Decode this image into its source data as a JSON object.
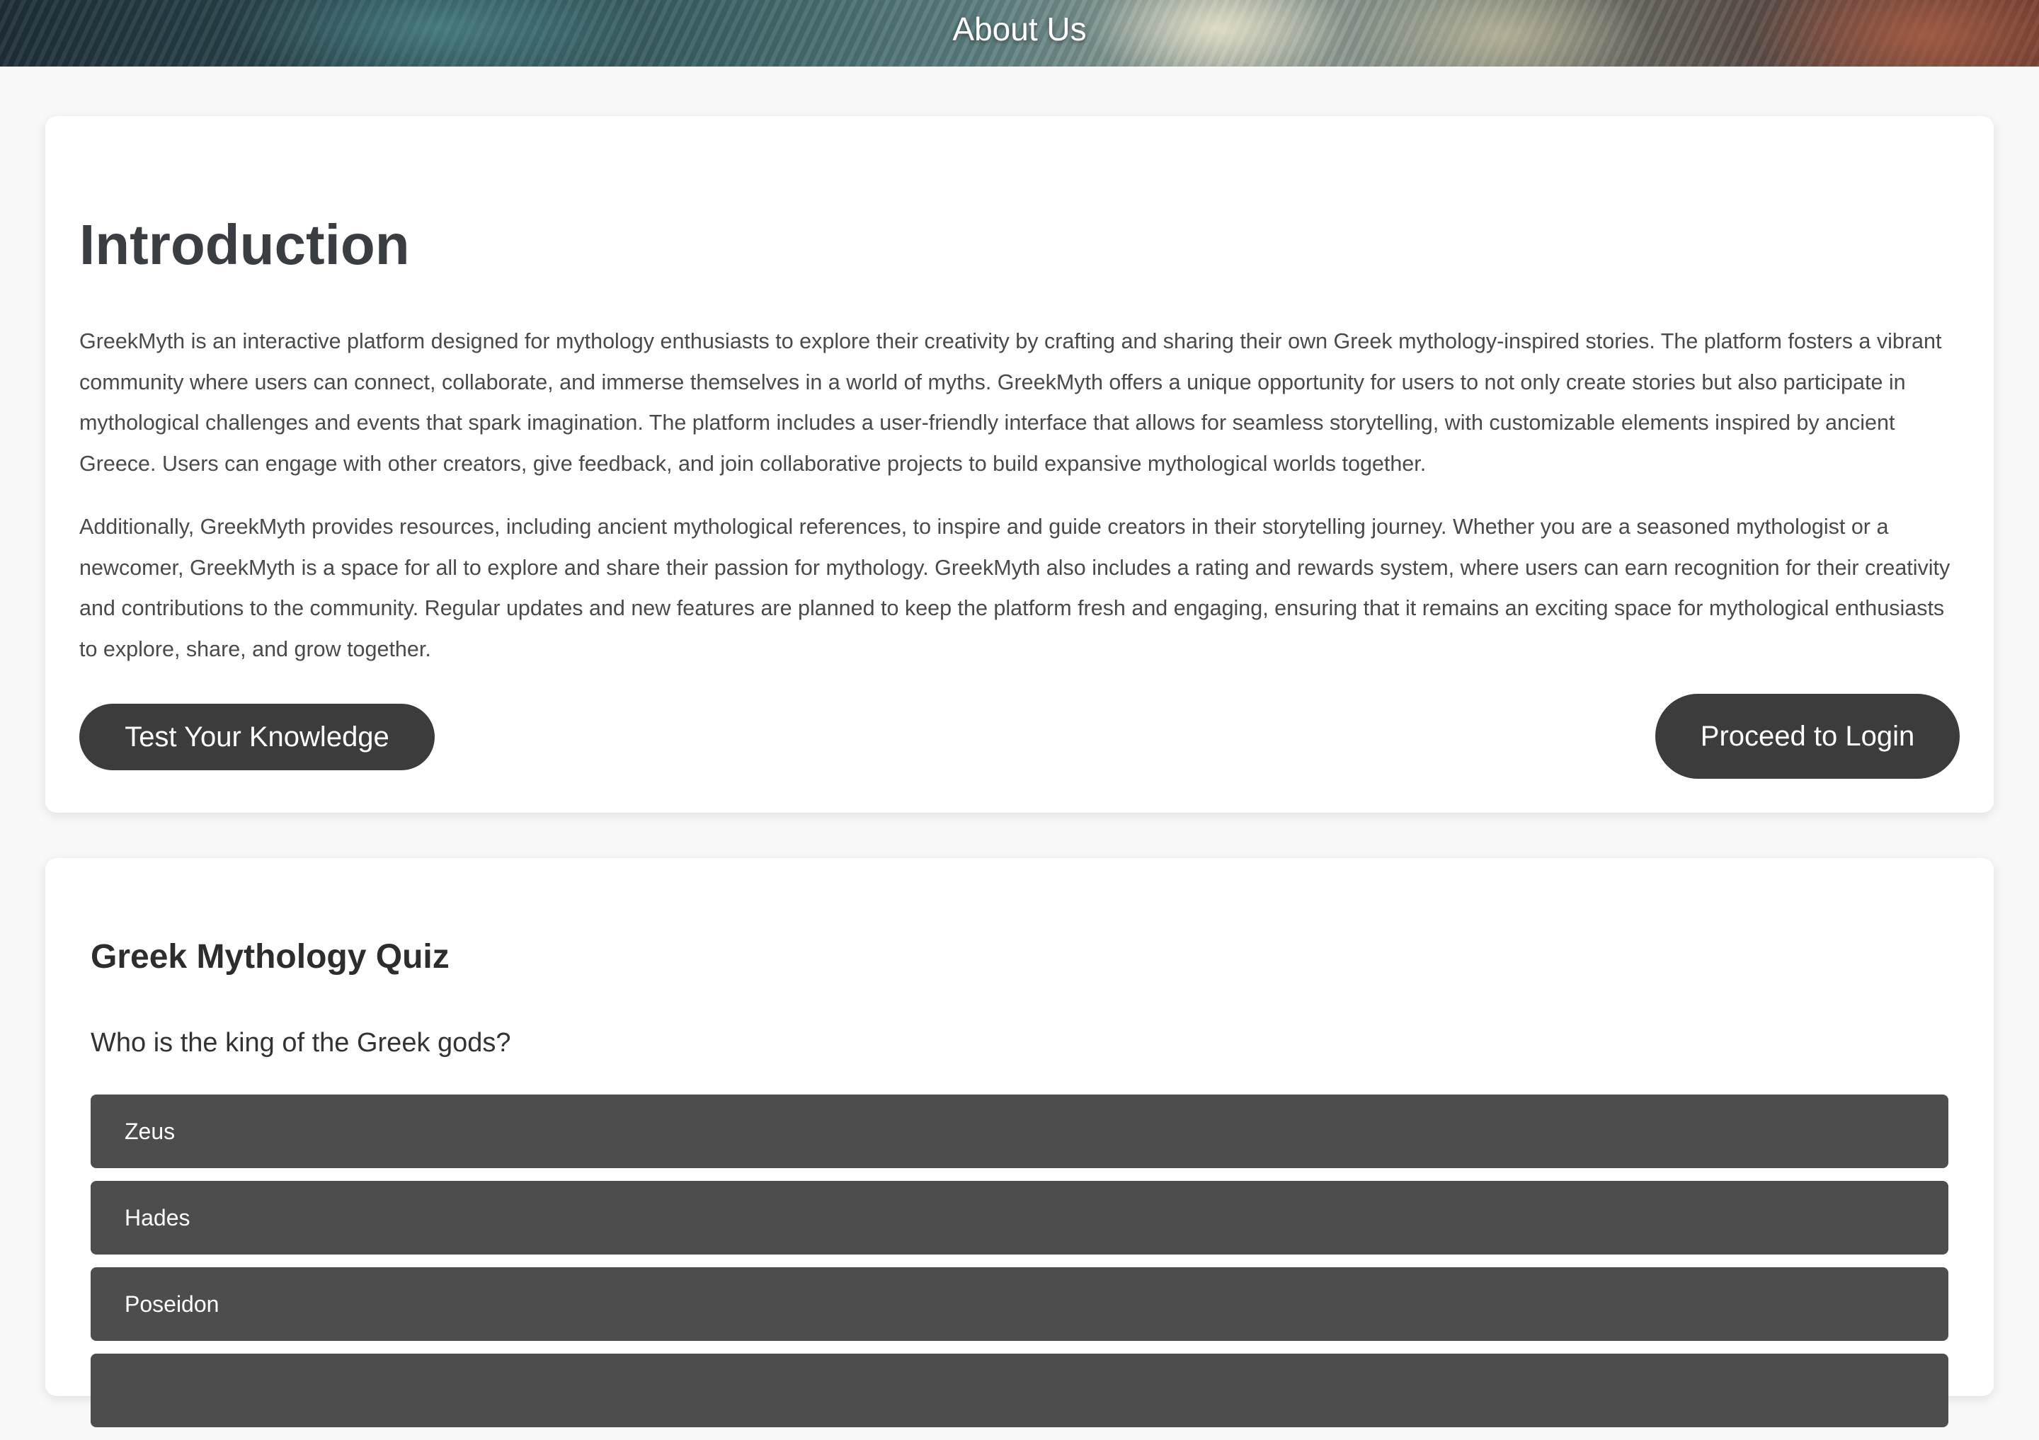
{
  "header": {
    "title": "About Us"
  },
  "intro": {
    "title": "Introduction",
    "paragraphs": [
      "GreekMyth is an interactive platform designed for mythology enthusiasts to explore their creativity by crafting and sharing their own Greek mythology-inspired stories. The platform fosters a vibrant community where users can connect, collaborate, and immerse themselves in a world of myths. GreekMyth offers a unique opportunity for users to not only create stories but also participate in mythological challenges and events that spark imagination. The platform includes a user-friendly interface that allows for seamless storytelling, with customizable elements inspired by ancient Greece. Users can engage with other creators, give feedback, and join collaborative projects to build expansive mythological worlds together.",
      "Additionally, GreekMyth provides resources, including ancient mythological references, to inspire and guide creators in their storytelling journey. Whether you are a seasoned mythologist or a newcomer, GreekMyth is a space for all to explore and share their passion for mythology. GreekMyth also includes a rating and rewards system, where users can earn recognition for their creativity and contributions to the community. Regular updates and new features are planned to keep the platform fresh and engaging, ensuring that it remains an exciting space for mythological enthusiasts to explore, share, and grow together."
    ],
    "quiz_button_label": "Test Your Knowledge",
    "login_button_label": "Proceed to Login"
  },
  "quiz": {
    "title": "Greek Mythology Quiz",
    "question": "Who is the king of the Greek gods?",
    "options": [
      "Zeus",
      "Hades",
      "Poseidon",
      ""
    ]
  },
  "colors": {
    "page_background": "#f8f8f8",
    "button_dark": "#3c3c3c",
    "option_background": "#4d4d4d",
    "heading_text": "#3a3d42"
  }
}
